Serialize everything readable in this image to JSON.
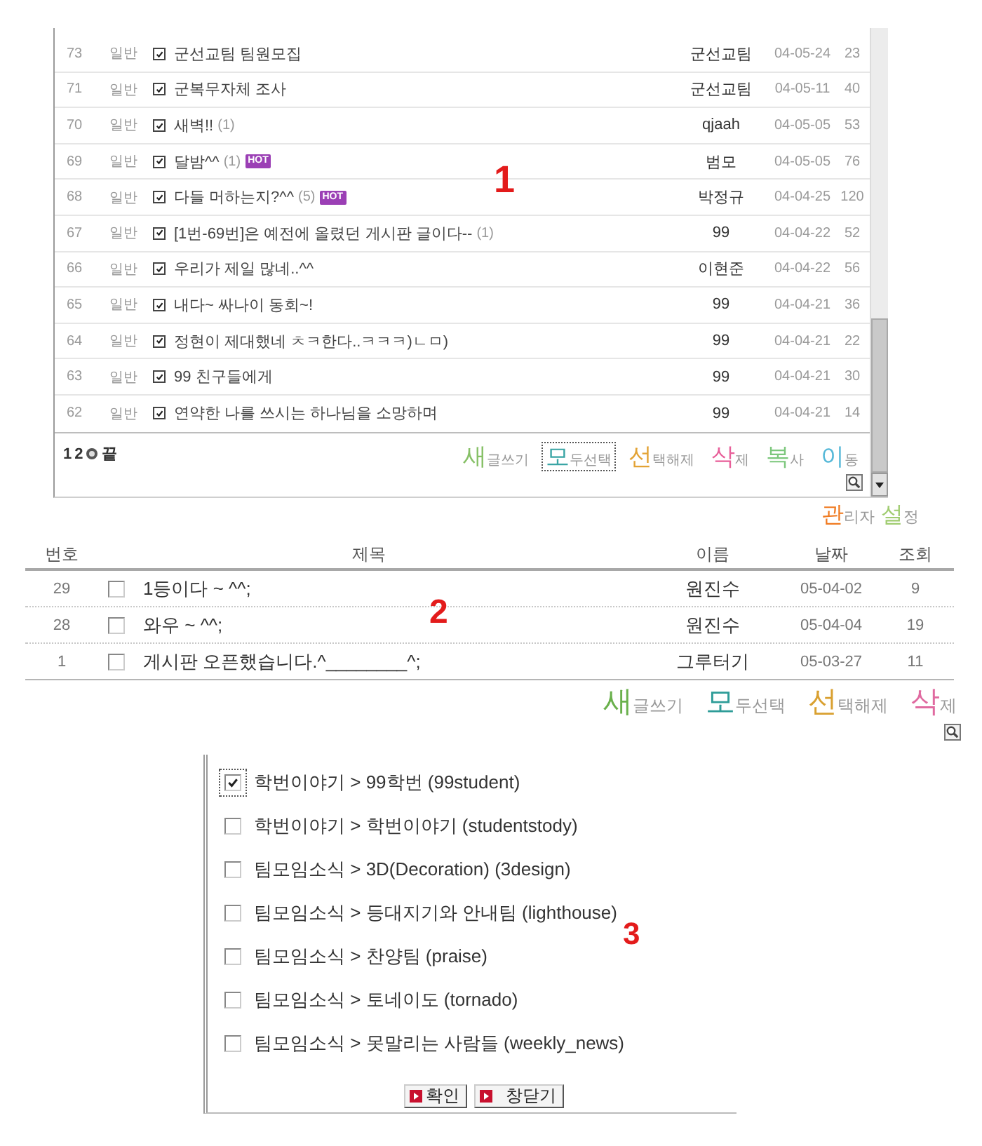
{
  "board_top": {
    "annotation": "1",
    "rows": [
      {
        "number": "73",
        "category": "일반",
        "checked": true,
        "title": "군선교팀 팀원모집",
        "author": "군선교팀",
        "date": "04-05-24",
        "views": "23"
      },
      {
        "number": "71",
        "category": "일반",
        "checked": true,
        "title": "군복무자체 조사",
        "author": "군선교팀",
        "date": "04-05-11",
        "views": "40"
      },
      {
        "number": "70",
        "category": "일반",
        "checked": true,
        "title": "새벽!!",
        "comments": "(1)",
        "author": "qjaah",
        "date": "04-05-05",
        "views": "53"
      },
      {
        "number": "69",
        "category": "일반",
        "checked": true,
        "title": "달밤^^",
        "comments": "(1)",
        "badge": "HOT",
        "author": "범모",
        "date": "04-05-05",
        "views": "76"
      },
      {
        "number": "68",
        "category": "일반",
        "checked": true,
        "title": "다들 머하는지?^^",
        "comments": "(5)",
        "badge": "HOT",
        "author": "박정규",
        "date": "04-04-25",
        "views": "120"
      },
      {
        "number": "67",
        "category": "일반",
        "checked": true,
        "title": "[1번-69번]은 예전에 올렸던 게시판 글이다--",
        "comments": "(1)",
        "author": "99",
        "date": "04-04-22",
        "views": "52"
      },
      {
        "number": "66",
        "category": "일반",
        "checked": true,
        "title": "우리가 제일 많네..^^",
        "author": "이현준",
        "date": "04-04-22",
        "views": "56"
      },
      {
        "number": "65",
        "category": "일반",
        "checked": true,
        "title": "내다~ 싸나이 동회~!",
        "author": "99",
        "date": "04-04-21",
        "views": "36"
      },
      {
        "number": "64",
        "category": "일반",
        "checked": true,
        "title": "정현이 제대했네 ㅊㅋ한다..ㅋㅋㅋ)ㄴㅁ)",
        "author": "99",
        "date": "04-04-21",
        "views": "22"
      },
      {
        "number": "63",
        "category": "일반",
        "checked": true,
        "title": "99 친구들에게",
        "author": "99",
        "date": "04-04-21",
        "views": "30"
      },
      {
        "number": "62",
        "category": "일반",
        "checked": true,
        "title": "연약한 나를 쓰시는 하나님을 소망하며",
        "author": "99",
        "date": "04-04-21",
        "views": "14"
      }
    ],
    "pagination": {
      "pages": [
        "1",
        "2"
      ],
      "last": "끝"
    },
    "tools": [
      {
        "lead": "새",
        "rest": "글쓰기",
        "color": "#86c066",
        "focused": false
      },
      {
        "lead": "모",
        "rest": "두선택",
        "color": "#3aa5a5",
        "focused": true
      },
      {
        "lead": "선",
        "rest": "택해제",
        "color": "#e3a335",
        "focused": false
      },
      {
        "lead": "삭",
        "rest": "제",
        "color": "#e8609a",
        "focused": false
      },
      {
        "lead": "복",
        "rest": "사",
        "color": "#7cc77c",
        "focused": false
      },
      {
        "lead": "이",
        "rest": "동",
        "color": "#55b8d8",
        "focused": false
      }
    ]
  },
  "admin_settings": [
    {
      "lead": "관",
      "rest": "리자",
      "color": "#f07a20"
    },
    {
      "lead": "설",
      "rest": "정",
      "color": "#a0cc70"
    }
  ],
  "board_bottom": {
    "annotation": "2",
    "columns": [
      "번호",
      "제목",
      "이름",
      "날짜",
      "조회"
    ],
    "rows": [
      {
        "number": "29",
        "checked": false,
        "title": "1등이다 ~ ^^;",
        "author": "원진수",
        "date": "05-04-02",
        "views": "9"
      },
      {
        "number": "28",
        "checked": false,
        "title": "와우 ~ ^^;",
        "author": "원진수",
        "date": "05-04-04",
        "views": "19"
      },
      {
        "number": "1",
        "checked": false,
        "title": "게시판 오픈했습니다.^________^;",
        "author": "그루터기",
        "date": "05-03-27",
        "views": "11"
      }
    ],
    "tools": [
      {
        "lead": "새",
        "rest": "글쓰기",
        "color": "#6ab04c"
      },
      {
        "lead": "모",
        "rest": "두선택",
        "color": "#2e9c98"
      },
      {
        "lead": "선",
        "rest": "택해제",
        "color": "#d9a030"
      },
      {
        "lead": "삭",
        "rest": "제",
        "color": "#e06aa0"
      }
    ]
  },
  "board_picker": {
    "annotation": "3",
    "options": [
      {
        "label": "학번이야기 > 99학번 (99student)",
        "checked": true,
        "focused": true
      },
      {
        "label": "학번이야기 > 학번이야기 (studentstody)",
        "checked": false,
        "focused": false
      },
      {
        "label": "팀모임소식 > 3D(Decoration) (3design)",
        "checked": false,
        "focused": false
      },
      {
        "label": "팀모임소식 > 등대지기와 안내팀 (lighthouse)",
        "checked": false,
        "focused": false
      },
      {
        "label": "팀모임소식 > 찬양팀 (praise)",
        "checked": false,
        "focused": false
      },
      {
        "label": "팀모임소식 > 토네이도 (tornado)",
        "checked": false,
        "focused": false
      },
      {
        "label": "팀모임소식 > 못말리는 사람들 (weekly_news)",
        "checked": false,
        "focused": false
      }
    ],
    "buttons": [
      "확인",
      "창닫기"
    ]
  }
}
